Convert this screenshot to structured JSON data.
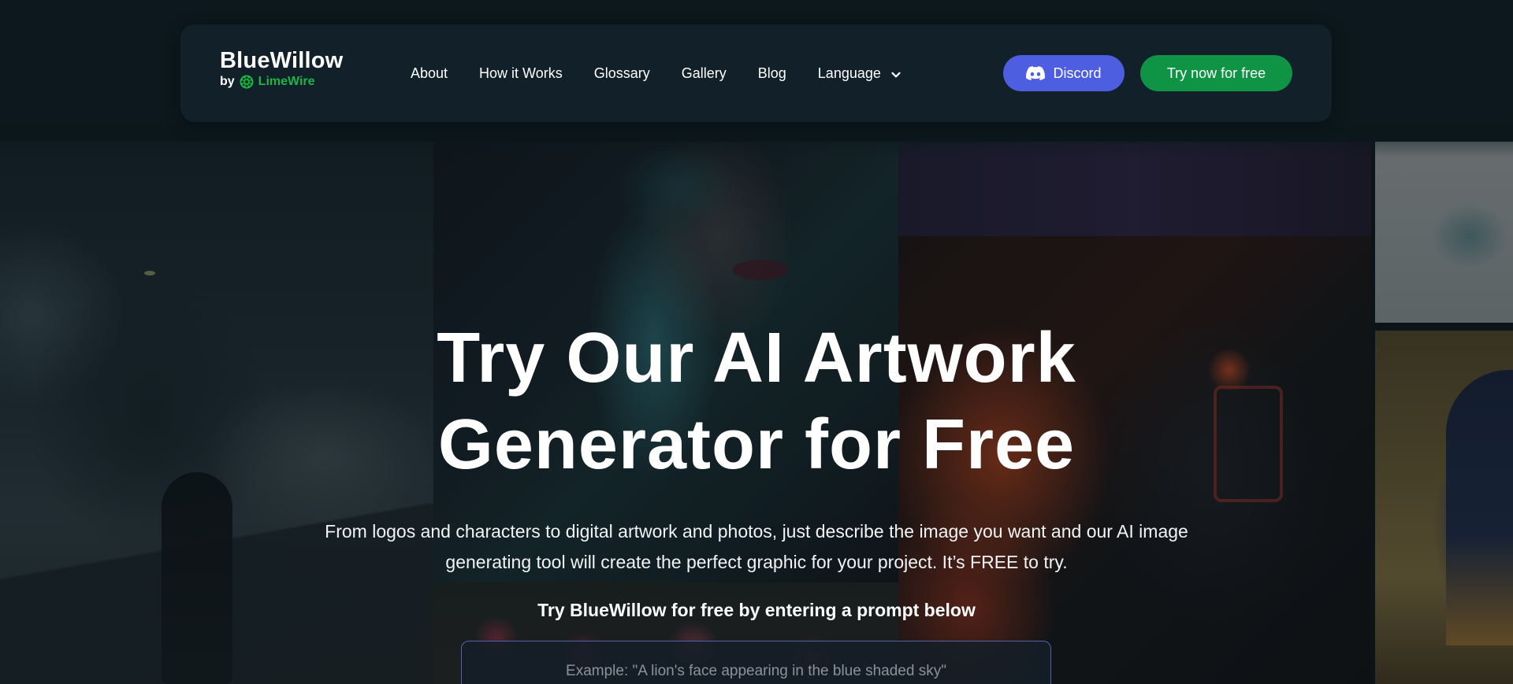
{
  "brand": {
    "name": "BlueWillow",
    "by": "by",
    "partner": "LimeWire",
    "partner_color": "#1fb347"
  },
  "nav": {
    "links": [
      {
        "label": "About"
      },
      {
        "label": "How it Works"
      },
      {
        "label": "Glossary"
      },
      {
        "label": "Gallery"
      },
      {
        "label": "Blog"
      },
      {
        "label": "Language",
        "icon": "chevron-down-icon"
      }
    ],
    "discord_button": {
      "label": "Discord",
      "icon": "discord-icon",
      "color": "#4d5fe0"
    },
    "try_button": {
      "label": "Try now for free",
      "color": "#0f9446"
    }
  },
  "hero": {
    "title_line1": "Try Our AI Artwork",
    "title_line2": "Generator for Free",
    "description_line1": "From logos and characters to digital artwork and photos,  just describe the image you want and our AI image",
    "description_line2": "generating tool will create the perfect graphic for your project. It’s FREE to try.",
    "cta": "Try BlueWillow for free by entering a prompt below",
    "prompt_placeholder": "Example: \"A lion's face appearing in the blue shaded sky\"",
    "prompt_value": ""
  },
  "colors": {
    "nav_background": "#12202a",
    "page_background": "#0f1c21",
    "prompt_border": "#5560a8"
  }
}
